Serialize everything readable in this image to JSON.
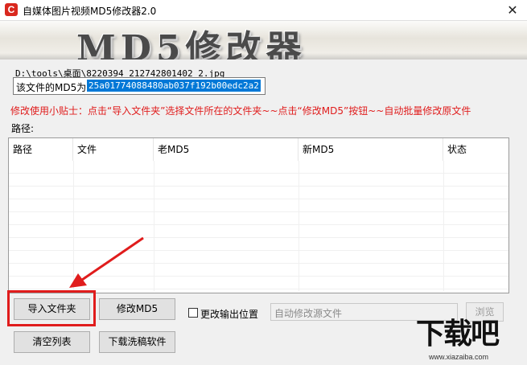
{
  "window": {
    "title": "自媒体图片视频MD5修改器2.0",
    "close_glyph": "✕",
    "app_icon_glyph": "C"
  },
  "banner": {
    "text": "MD5修改器"
  },
  "file": {
    "path": "D:\\tools\\桌面\\8220394_212742801402_2.jpg",
    "md5_label": "该文件的MD5为:",
    "md5_value": "25a01774088480ab037f192b00edc2a2"
  },
  "tip": "修改使用小贴士：点击“导入文件夹”选择文件所在的文件夹~~点击“修改MD5”按钮~~自动批量修改原文件",
  "path_label": "路径:",
  "table": {
    "columns": [
      "路径",
      "文件",
      "老MD5",
      "新MD5",
      "状态"
    ],
    "rows": []
  },
  "buttons": {
    "import_folder": "导入文件夹",
    "modify_md5": "修改MD5",
    "clear_list": "清空列表",
    "download_software": "下载洗稿软件",
    "browse": "浏览"
  },
  "output": {
    "checkbox_label": "更改输出位置",
    "checked": false,
    "placeholder": "自动修改源文件"
  },
  "watermark": {
    "text": "下载吧",
    "url": "www.xiazaiba.com"
  },
  "colors": {
    "accent_red": "#e01c1c",
    "selection_blue": "#0078d7"
  }
}
